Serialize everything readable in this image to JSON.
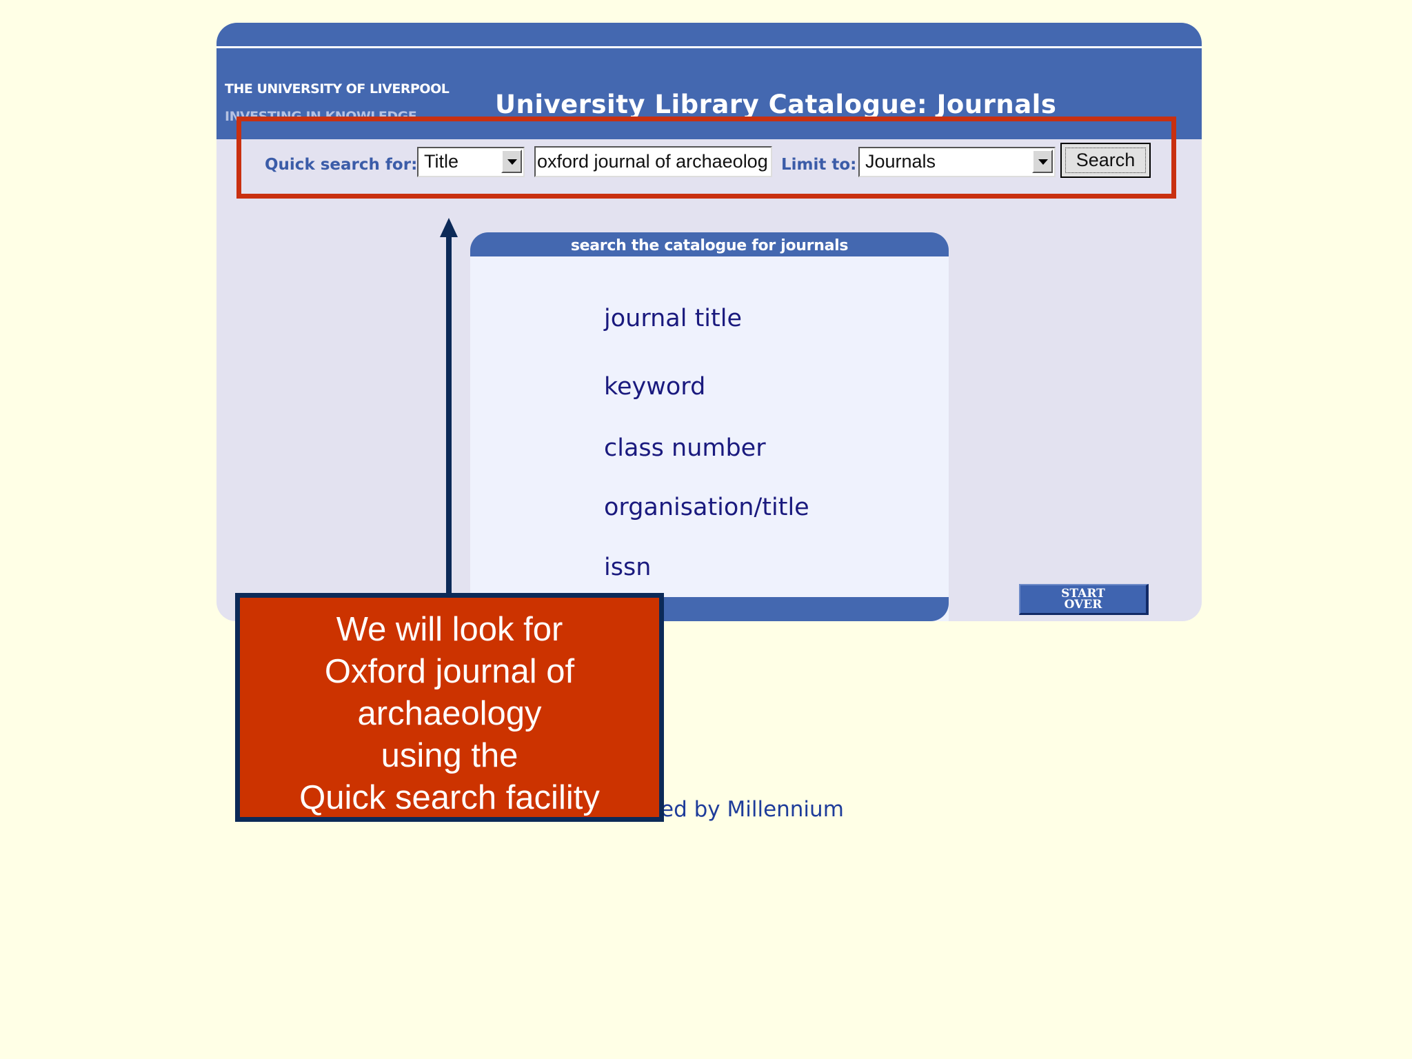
{
  "header": {
    "university": "THE UNIVERSITY OF LIVERPOOL",
    "tagline": "INVESTING IN KNOWLEDGE",
    "title": "University Library Catalogue: Journals"
  },
  "quick_search": {
    "label": "Quick search for:",
    "field_selected": "Title",
    "query_value": "oxford journal of archaeolog",
    "limit_label": "Limit to:",
    "limit_selected": "Journals",
    "search_button": "Search"
  },
  "panel": {
    "heading": "search the catalogue for journals",
    "links": [
      "journal title",
      "keyword",
      "class number",
      "organisation/title",
      "issn"
    ]
  },
  "start_over": {
    "line1": "START",
    "line2": "OVER"
  },
  "footer": {
    "powered_text": "ed by Millennium"
  },
  "callout": {
    "text": "We will look for\nOxford journal of\narchaeology\nusing the\nQuick search facility"
  },
  "colors": {
    "page_bg": "#ffffe6",
    "header_blue": "#4468b0",
    "highlight_red": "#c93010",
    "callout_red": "#cc3300",
    "navy": "#0c2a58"
  }
}
